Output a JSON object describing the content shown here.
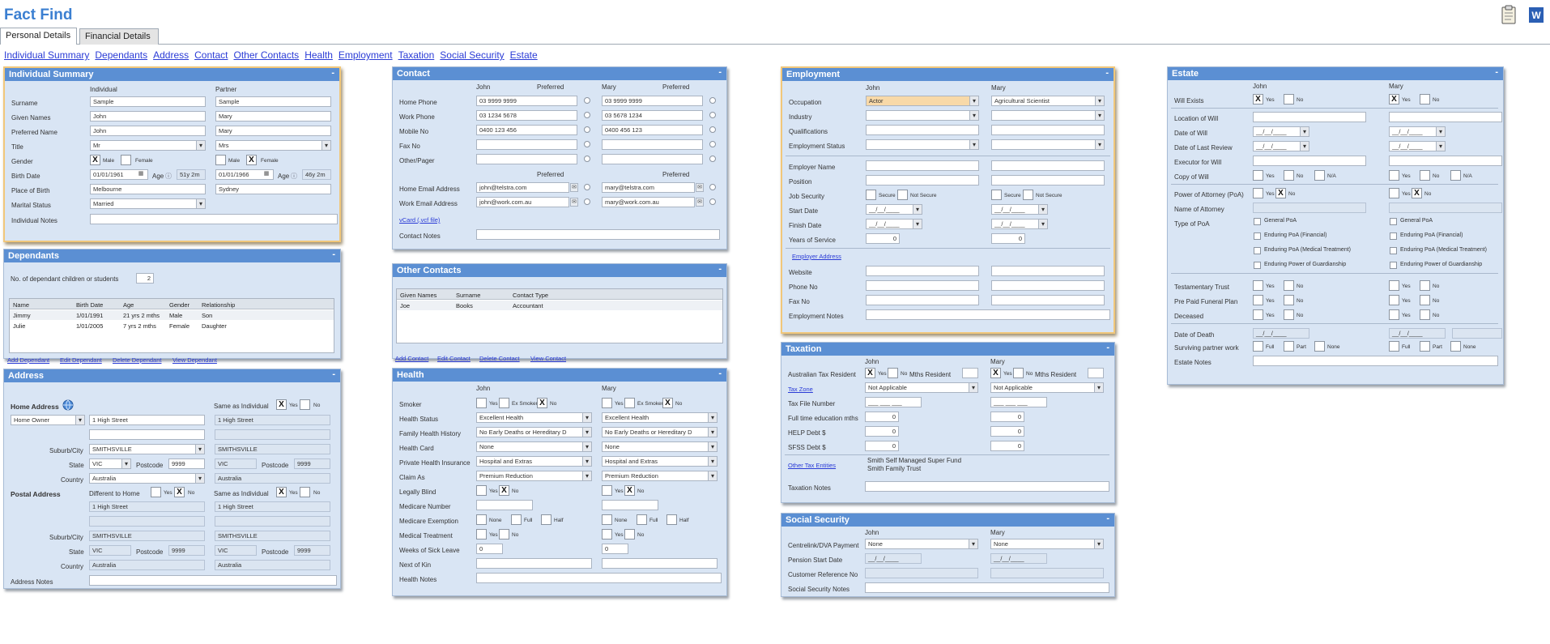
{
  "title": "Fact Find",
  "icons": {
    "clipboard": "clipboard-icon",
    "word": "word-document-icon"
  },
  "tabs": [
    "Personal Details",
    "Financial Details"
  ],
  "nav": [
    "Individual Summary",
    "Dependants",
    "Address",
    "Contact",
    "Other Contacts",
    "Health",
    "Employment",
    "Taxation",
    "Social Security",
    "Estate"
  ],
  "collapse": "-",
  "ind": {
    "title": "Individual Summary",
    "col1": "Individual",
    "col2": "Partner",
    "labels": [
      "Surname",
      "Given Names",
      "Preferred Name",
      "Title",
      "Gender",
      "Birth Date",
      "Place of Birth",
      "Marital Status",
      "Individual Notes"
    ],
    "surname": [
      "Sample",
      "Sample"
    ],
    "given": [
      "John",
      "Mary"
    ],
    "preferred": [
      "John",
      "Mary"
    ],
    "title_val": [
      "Mr",
      "Mrs"
    ],
    "male": "Male",
    "female": "Female",
    "x": "X",
    "age": "Age",
    "birth": [
      "01/01/1961",
      "01/01/1966"
    ],
    "ages": [
      "51y 2m",
      "46y 2m"
    ],
    "place": [
      "Melbourne",
      "Sydney"
    ],
    "marital": "Married"
  },
  "dep": {
    "title": "Dependants",
    "count_label": "No. of dependant children or students",
    "count": "2",
    "cols": [
      "Name",
      "Birth Date",
      "Age",
      "Gender",
      "Relationship"
    ],
    "rows": [
      [
        "Jimmy",
        "1/01/1991",
        "21 yrs 2 mths",
        "Male",
        "Son"
      ],
      [
        "Julie",
        "1/01/2005",
        "7 yrs 2 mths",
        "Female",
        "Daughter"
      ]
    ],
    "links": [
      "Add Dependant",
      "Edit Dependant",
      "Delete Dependant",
      "View Dependant"
    ]
  },
  "addr": {
    "title": "Address",
    "home": "Home Address",
    "owner": "Home Owner",
    "street": "1 High Street",
    "same": "Same as Individual",
    "yes": "Yes",
    "no": "No",
    "suburb_l": "Suburb/City",
    "suburb": "SMITHSVILLE",
    "state_l": "State",
    "state": "VIC",
    "postcode_l": "Postcode",
    "postcode": "9999",
    "country_l": "Country",
    "country": "Australia",
    "postal": "Postal Address",
    "diff": "Different to Home",
    "notes": "Address Notes"
  },
  "contact": {
    "title": "Contact",
    "john": "John",
    "mary": "Mary",
    "pref": "Preferred",
    "labels": [
      "Home Phone",
      "Work Phone",
      "Mobile No",
      "Fax No",
      "Other/Pager",
      "Home Email Address",
      "Work Email Address"
    ],
    "home": [
      "03 9999 9999",
      "03 9999 9999"
    ],
    "work": [
      "03 1234 5678",
      "03 5678 1234"
    ],
    "mobile": [
      "0400 123 456",
      "0400 456 123"
    ],
    "hemail": [
      "john@telstra.com",
      "mary@telstra.com"
    ],
    "wemail": [
      "john@work.com.au",
      "mary@work.com.au"
    ],
    "vcard": "vCard (.vcf file)",
    "notes": "Contact Notes"
  },
  "oc": {
    "title": "Other Contacts",
    "cols": [
      "Given Names",
      "Surname",
      "Contact Type"
    ],
    "row": [
      "Joe",
      "Books",
      "Accountant"
    ],
    "links": [
      "Add Contact",
      "Edit Contact",
      "Delete Contact",
      "View Contact"
    ]
  },
  "health": {
    "title": "Health",
    "john": "John",
    "mary": "Mary",
    "labels": [
      "Smoker",
      "Health Status",
      "Family Health History",
      "Health Card",
      "Private Health Insurance",
      "Claim As",
      "Legally Blind",
      "Medicare Number",
      "Medicare Exemption",
      "Medical Treatment",
      "Weeks of Sick Leave",
      "Next of Kin",
      "Health Notes"
    ],
    "yes": "Yes",
    "no": "No",
    "exsmoker": "Ex Smoker",
    "status": "Excellent Health",
    "family": "No Early Deaths or Hereditary D",
    "card": "None",
    "insurance": "Hospital and Extras",
    "claim": "Premium Reduction",
    "none": "None",
    "full": "Full",
    "half": "Half",
    "weeks": "0"
  },
  "emp": {
    "title": "Employment",
    "john": "John",
    "mary": "Mary",
    "labels": [
      "Occupation",
      "Industry",
      "Qualifications",
      "Employment Status",
      "Employer Name",
      "Position",
      "Job Security",
      "Start Date",
      "Finish Date",
      "Years of Service",
      "Website",
      "Phone No",
      "Fax No",
      "Employment Notes"
    ],
    "occ": [
      "Actor",
      "Agricultural Scientist"
    ],
    "secure": "Secure",
    "notsecure": "Not Secure",
    "date": "__/__/____",
    "years": "0",
    "emp_addr": "Employer Address"
  },
  "tax": {
    "title": "Taxation",
    "john": "John",
    "mary": "Mary",
    "labels": [
      "Australian Tax Resident",
      "Tax Zone",
      "Tax File Number",
      "Full time education mths",
      "HELP Debt $",
      "SFSS Debt $",
      "Other Tax Entities",
      "Taxation Notes"
    ],
    "yes": "Yes",
    "no": "No",
    "mths": "Mths Resident",
    "zone": "Not Applicable",
    "tfn": "___ ___ ___",
    "zero": "0",
    "entities": [
      "Smith Self Managed Super Fund",
      "Smith Family Trust"
    ]
  },
  "ss": {
    "title": "Social Security",
    "john": "John",
    "mary": "Mary",
    "labels": [
      "Centrelink/DVA Payment",
      "Pension Start Date",
      "Customer Reference No",
      "Social Security Notes"
    ],
    "none": "None",
    "date": "__/__/____"
  },
  "estate": {
    "title": "Estate",
    "john": "John",
    "mary": "Mary",
    "labels": [
      "Will Exists",
      "Location of Will",
      "Date of Will",
      "Date of Last Review",
      "Executor for Will",
      "Copy of Will",
      "Power of Attorney (PoA)",
      "Name of Attorney",
      "Type of PoA",
      "Testamentary Trust",
      "Pre Paid Funeral Plan",
      "Deceased",
      "Date of Death",
      "Surviving partner work",
      "Estate Notes"
    ],
    "yes": "Yes",
    "no": "No",
    "na": "N/A",
    "x": "X",
    "full": "Full",
    "part": "Part",
    "none": "None",
    "date": "__/__/____",
    "poa": [
      "General PoA",
      "Enduring PoA (Financial)",
      "Enduring PoA (Medical Treatment)",
      "Enduring Power of Guardianship"
    ]
  }
}
